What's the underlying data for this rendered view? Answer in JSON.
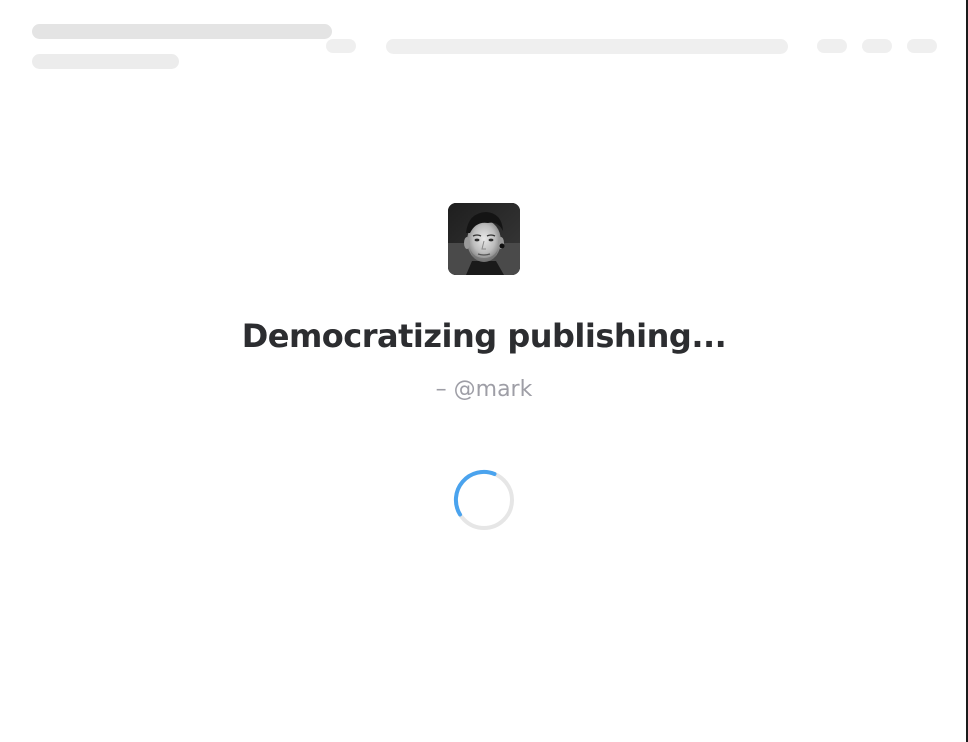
{
  "loading_screen": {
    "quote": "Democratizing publishing...",
    "attribution": "– @mark",
    "avatar_alt": "mark avatar"
  },
  "colors": {
    "skeleton": "#e4e4e4",
    "heading": "#2c2d30",
    "muted": "#9e9ea6",
    "spinner_accent": "#4aa3ee",
    "spinner_track": "#e6e6e6"
  },
  "icons": {
    "loading": "spinner-icon"
  }
}
